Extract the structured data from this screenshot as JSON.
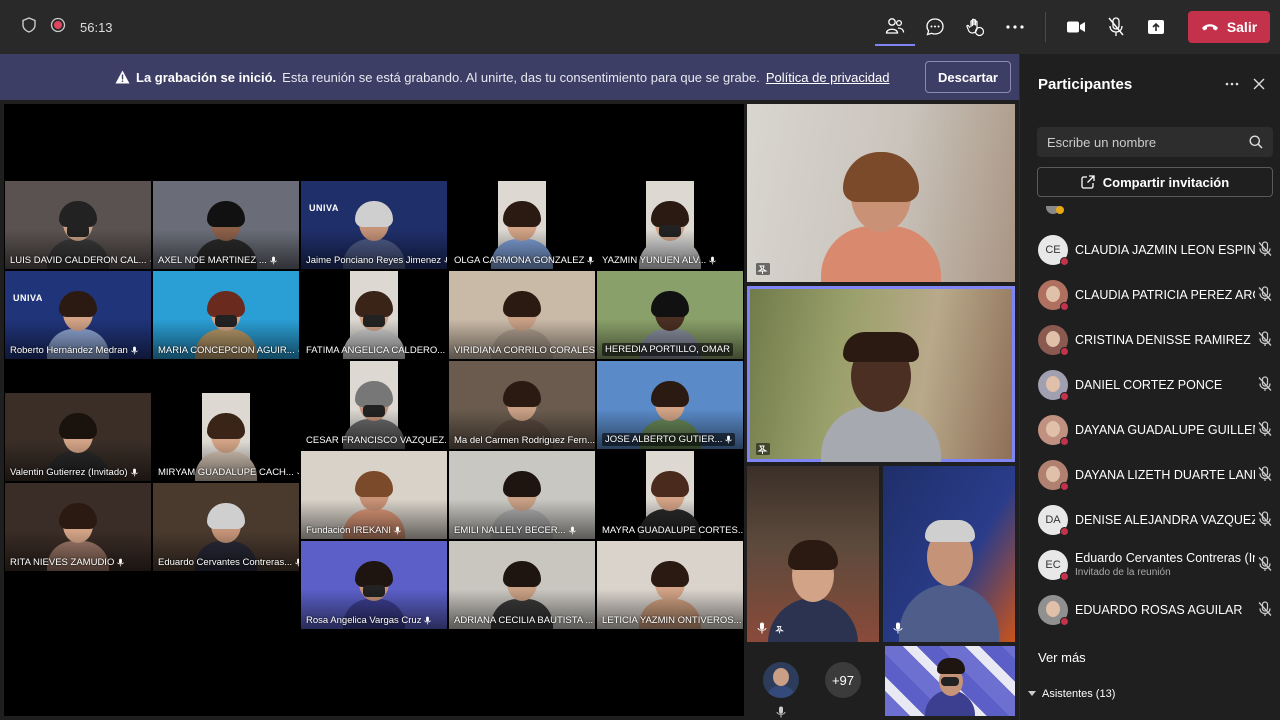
{
  "topbar": {
    "timer": "56:13",
    "leave_label": "Salir"
  },
  "banner": {
    "title": "La grabación se inició.",
    "message": "Esta reunión se está grabando. Al unirte, das tu consentimiento para que se grabe.",
    "link": "Política de privacidad",
    "dismiss_label": "Descartar"
  },
  "grid": {
    "tiles": [
      "LUIS DAVID CALDERON CAL...",
      "AXEL NOE MARTINEZ ...",
      "Jaime Ponciano Reyes Jimenez",
      "OLGA CARMONA GONZALEZ",
      "YAZMIN YUNUEN ALV...",
      "Roberto Hernández Medran",
      "MARIA CONCEPCION AGUIR...",
      "FATIMA ANGELICA CALDERO...",
      "VIRIDIANA CORRILO CORALES",
      "HEREDIA PORTILLO, OMAR",
      "CESAR FRANCISCO VAZQUEZ...",
      "Ma del Carmen Rodriguez Fern...",
      "JOSE ALBERTO GUTIER...",
      "Valentin Gutierrez (Invitado)",
      "MIRYAM GUADALUPE CACH...",
      "Fundación IREKANI",
      "EMILI NALLELY BECER...",
      "MAYRA GUADALUPE CORTES...",
      "RITA NIEVES ZAMUDIO",
      "Eduardo Cervantes Contreras...",
      "Rosa Angelica Vargas Cruz",
      "ADRIANA CECILIA BAUTISTA ...",
      "LETICIA YAZMIN ONTIVEROS..."
    ],
    "logo_text": "UNIVA"
  },
  "featured": {
    "more_count": "+97"
  },
  "panel": {
    "title": "Participantes",
    "search_placeholder": "Escribe un nombre",
    "share_label": "Compartir invitación",
    "participants": [
      {
        "initials": "CE",
        "name": "CLAUDIA JAZMIN LEON ESPINO..."
      },
      {
        "initials": "",
        "name": "CLAUDIA PATRICIA PEREZ ARGU..."
      },
      {
        "initials": "",
        "name": "CRISTINA DENISSE RAMIREZ ME..."
      },
      {
        "initials": "",
        "name": "DANIEL CORTEZ PONCE"
      },
      {
        "initials": "",
        "name": "DAYANA GUADALUPE GUILLEN ..."
      },
      {
        "initials": "",
        "name": "DAYANA LIZETH DUARTE LANDE..."
      },
      {
        "initials": "DA",
        "name": "DENISE ALEJANDRA VAZQUEZ ..."
      },
      {
        "initials": "EC",
        "name": "Eduardo Cervantes Contreras (In...",
        "sub": "Invitado de la reunión"
      },
      {
        "initials": "",
        "name": "EDUARDO ROSAS AGUILAR"
      }
    ],
    "see_more": "Ver más",
    "attendees_label": "Asistentes (13)"
  },
  "colors": {
    "accent": "#7f85f5",
    "leave": "#c4314b",
    "banner": "#3d3e66"
  }
}
